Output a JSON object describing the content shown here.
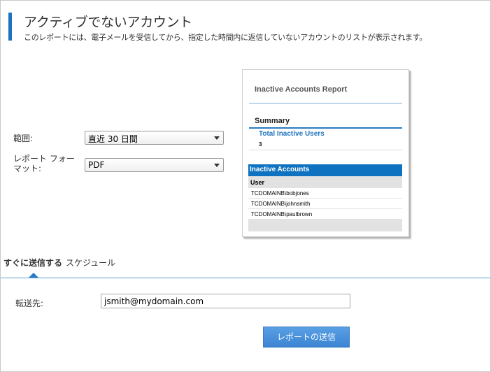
{
  "header": {
    "title": "アクティブでないアカウント",
    "subtitle": "このレポートには、電子メールを受信してから、指定した時間内に返信していないアカウントのリストが表示されます。"
  },
  "form": {
    "range_label": "範囲:",
    "range_value": "直近 30 日間",
    "format_label": "レポート フォーマット:",
    "format_value": "PDF"
  },
  "preview": {
    "title": "Inactive Accounts Report",
    "summary_heading": "Summary",
    "total_label": "Total Inactive Users",
    "total_value": "3",
    "section_heading": "Inactive Accounts",
    "column_header": "User",
    "rows": [
      "TCDOMAINB\\bobjones",
      "TCDOMAINB\\johnsmith",
      "TCDOMAINB\\paulbrown"
    ]
  },
  "tabs": [
    {
      "label": "すぐに送信する",
      "active": true
    },
    {
      "label": "スケジュール",
      "active": false
    }
  ],
  "delivery": {
    "destination_label": "転送先:",
    "destination_value": "jsmith@mydomain.com",
    "send_button_label": "レポートの送信"
  },
  "colors": {
    "accent": "#1e73be",
    "button": "#4a90dc",
    "table_header": "#0f72c0"
  }
}
